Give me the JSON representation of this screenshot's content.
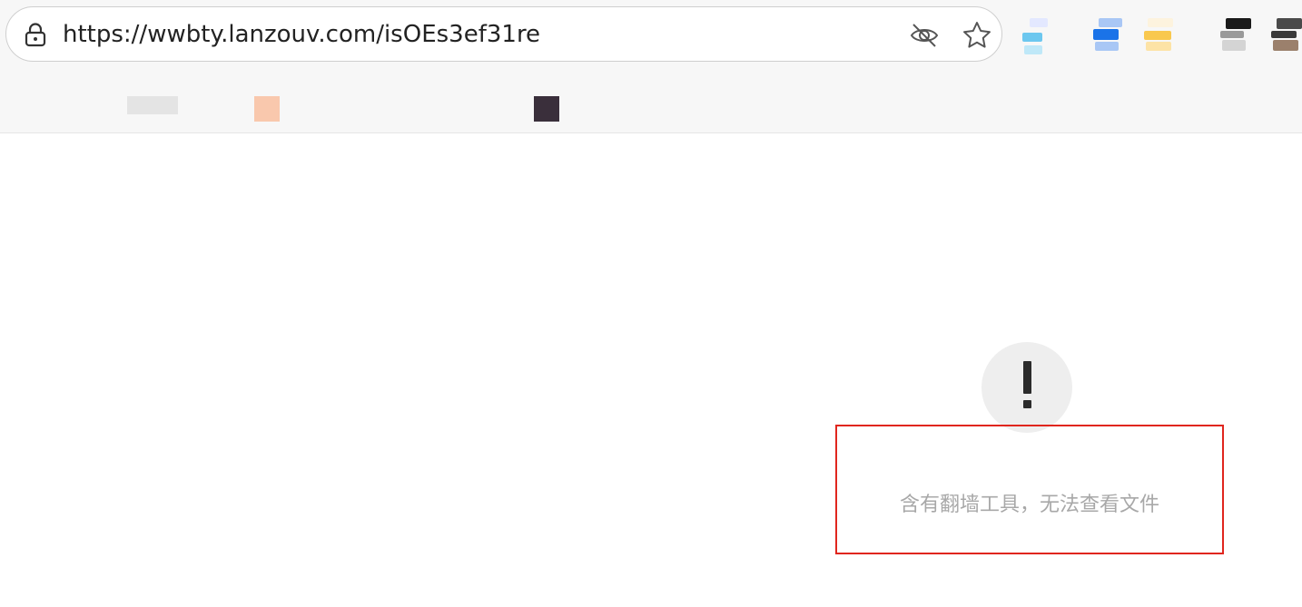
{
  "address_bar": {
    "url": "https://wwbty.lanzouv.com/isOEs3ef31re"
  },
  "toolbar": {
    "icons": [
      "lock-icon",
      "eye-off-icon",
      "star-icon"
    ],
    "extension_colors": [
      "#6cc7ef",
      "#1a73e8",
      "#f9c84e",
      "#1a1a1a",
      "#4a4a4a"
    ]
  },
  "page": {
    "alert_icon": "exclamation-icon",
    "message": "含有翻墙工具，无法查看文件",
    "highlight_color": "#e0261e"
  }
}
